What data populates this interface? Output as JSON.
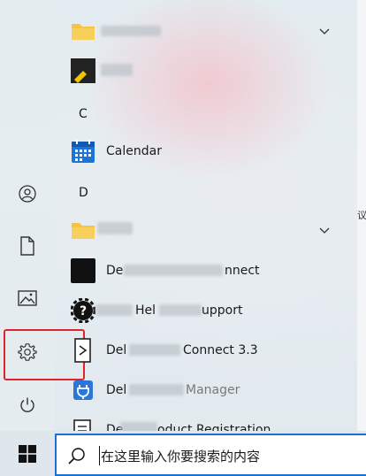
{
  "start_menu": {
    "groups": [
      {
        "type": "folder",
        "label": "",
        "expandable": true
      },
      {
        "type": "app",
        "label": ""
      },
      {
        "type": "letter",
        "label": "C"
      },
      {
        "type": "app",
        "label": "Calendar"
      },
      {
        "type": "letter",
        "label": "D"
      },
      {
        "type": "folder",
        "label": "",
        "expandable": true
      },
      {
        "type": "app",
        "label": "De",
        "label_tail": "nnect"
      },
      {
        "type": "app",
        "label": "",
        "label_mid": "Hel",
        "label_tail": "upport"
      },
      {
        "type": "app",
        "label": "Del",
        "label_tail": "Connect 3.3"
      },
      {
        "type": "app",
        "label": "Del",
        "label_tail": "Manager"
      },
      {
        "type": "app",
        "label": "De",
        "label_tail": "oduct Registration"
      }
    ]
  },
  "rail": {
    "items": [
      "user-icon",
      "document-icon",
      "pictures-icon",
      "settings-icon",
      "power-icon"
    ]
  },
  "right_edge_glyph": "议",
  "taskbar": {
    "start_icon": "windows-logo-icon",
    "search": {
      "placeholder": "在这里输入你要搜索的内容"
    }
  },
  "colors": {
    "highlight_border": "#e0242b",
    "search_border": "#1f6fd1",
    "folder": "#f6c342",
    "calendar_blue": "#1e73d8"
  }
}
